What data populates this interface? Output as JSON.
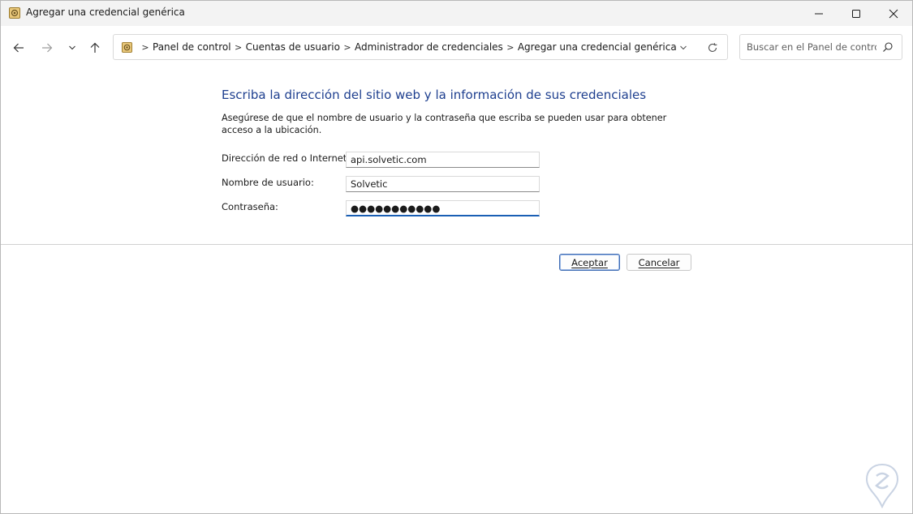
{
  "window": {
    "title": "Agregar una credencial genérica"
  },
  "navigation": {
    "breadcrumbs": [
      "Panel de control",
      "Cuentas de usuario",
      "Administrador de credenciales",
      "Agregar una credencial genérica"
    ],
    "search_placeholder": "Buscar en el Panel de control"
  },
  "form": {
    "heading": "Escriba la dirección del sitio web y la información de sus credenciales",
    "description": "Asegúrese de que el nombre de usuario y la contraseña que escriba se pueden usar para obtener acceso a la ubicación.",
    "address_label": "Dirección de red o Internet:",
    "address_value": "api.solvetic.com",
    "username_label": "Nombre de usuario:",
    "username_value": "Solvetic",
    "password_label": "Contraseña:",
    "password_value": "●●●●●●●●●●●"
  },
  "buttons": {
    "accept": "Aceptar",
    "cancel": "Cancelar"
  },
  "colors": {
    "heading": "#1e3f8f",
    "focus_accent": "#1a5fb4",
    "titlebar": "#f3f3f3"
  },
  "icons": [
    "control-panel-icon",
    "minimize-icon",
    "maximize-icon",
    "close-icon",
    "back-arrow-icon",
    "forward-arrow-icon",
    "chevron-down-icon",
    "up-arrow-icon",
    "refresh-icon",
    "search-icon",
    "watermark-logo"
  ]
}
